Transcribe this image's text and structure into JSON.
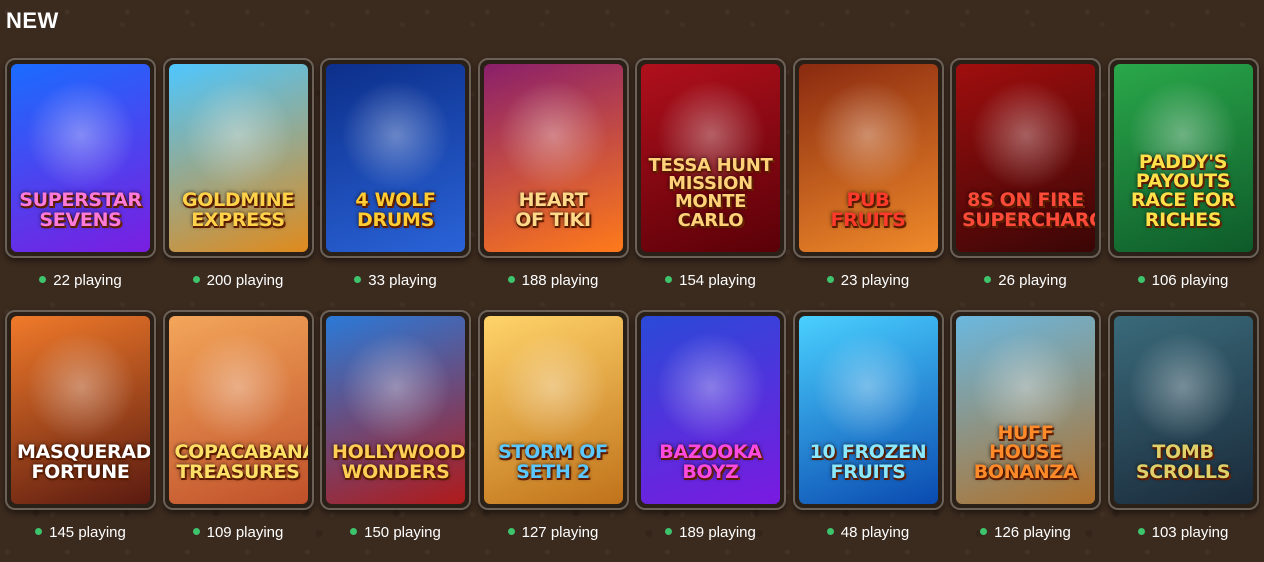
{
  "section": {
    "title": "NEW"
  },
  "games": [
    {
      "name_l1": "Superstar",
      "name_l2": "Sevens",
      "players": "22 playing",
      "bg": [
        "#1a6cff",
        "#7a1ee0"
      ],
      "logo_color": "#ff7ad9"
    },
    {
      "name_l1": "Goldmine",
      "name_l2": "Express",
      "players": "200 playing",
      "bg": [
        "#4ec7ff",
        "#e08a1c"
      ],
      "logo_color": "#ffd24a"
    },
    {
      "name_l1": "4 Wolf",
      "name_l2": "Drums",
      "players": "33 playing",
      "bg": [
        "#0c2f8a",
        "#2a63d8"
      ],
      "logo_color": "#ffcc33"
    },
    {
      "name_l1": "Heart",
      "name_l2": "of Tiki",
      "players": "188 playing",
      "bg": [
        "#8a1f6b",
        "#ff7a1a"
      ],
      "logo_color": "#ffd98a"
    },
    {
      "name_l1": "Tessa Hunt Mission",
      "name_l2": "Monte Carlo",
      "players": "154 playing",
      "bg": [
        "#b0101c",
        "#5a0008"
      ],
      "logo_color": "#ffd27a"
    },
    {
      "name_l1": "Pub",
      "name_l2": "Fruits",
      "players": "23 playing",
      "bg": [
        "#8a2a10",
        "#f08a2a"
      ],
      "logo_color": "#ff3a2a"
    },
    {
      "name_l1": "8s on Fire",
      "name_l2": "Supercharged",
      "players": "26 playing",
      "bg": [
        "#a00e0e",
        "#3a0606"
      ],
      "logo_color": "#ff4a3a"
    },
    {
      "name_l1": "Paddy's Payouts",
      "name_l2": "Race for Riches",
      "players": "106 playing",
      "bg": [
        "#2aa84a",
        "#0e5a2a"
      ],
      "logo_color": "#ffe14a"
    },
    {
      "name_l1": "Masquerade",
      "name_l2": "Fortune",
      "players": "145 playing",
      "bg": [
        "#f07a2a",
        "#5a1a10"
      ],
      "logo_color": "#ffffff"
    },
    {
      "name_l1": "Copacabana",
      "name_l2": "Treasures",
      "players": "109 playing",
      "bg": [
        "#f3a65a",
        "#c0502a"
      ],
      "logo_color": "#ffe066"
    },
    {
      "name_l1": "Hollywood",
      "name_l2": "Wonders",
      "players": "150 playing",
      "bg": [
        "#2a7ad8",
        "#b01a1a"
      ],
      "logo_color": "#ffcf55"
    },
    {
      "name_l1": "Storm of",
      "name_l2": "Seth 2",
      "players": "127 playing",
      "bg": [
        "#ffd36a",
        "#c0721a"
      ],
      "logo_color": "#5ac8ff"
    },
    {
      "name_l1": "Bazooka",
      "name_l2": "Boyz",
      "players": "189 playing",
      "bg": [
        "#2a4ad8",
        "#7a1ae0"
      ],
      "logo_color": "#ff4ae0"
    },
    {
      "name_l1": "10 Frozen",
      "name_l2": "Fruits",
      "players": "48 playing",
      "bg": [
        "#4ad0ff",
        "#0a4ab0"
      ],
      "logo_color": "#8ae8ff"
    },
    {
      "name_l1": "Huff House",
      "name_l2": "Bonanza",
      "players": "126 playing",
      "bg": [
        "#6ab8e0",
        "#b0702a"
      ],
      "logo_color": "#ff8a2a"
    },
    {
      "name_l1": "Tomb",
      "name_l2": "Scrolls",
      "players": "103 playing",
      "bg": [
        "#3a6a7a",
        "#1a2a3a"
      ],
      "logo_color": "#e0d06a"
    }
  ]
}
